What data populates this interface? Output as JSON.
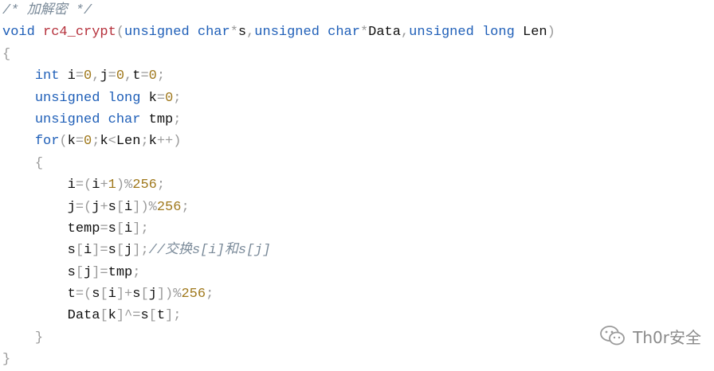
{
  "code_lines": [
    [
      {
        "t": "/* 加解密 */",
        "k": "cmt"
      }
    ],
    [
      {
        "t": "void",
        "k": "kw"
      },
      {
        "t": " ",
        "k": "var"
      },
      {
        "t": "rc4_crypt",
        "k": "fn"
      },
      {
        "t": "(",
        "k": "op"
      },
      {
        "t": "unsigned",
        "k": "kw"
      },
      {
        "t": " ",
        "k": "var"
      },
      {
        "t": "char",
        "k": "kw"
      },
      {
        "t": "*",
        "k": "op"
      },
      {
        "t": "s",
        "k": "var"
      },
      {
        "t": ",",
        "k": "op"
      },
      {
        "t": "unsigned",
        "k": "kw"
      },
      {
        "t": " ",
        "k": "var"
      },
      {
        "t": "char",
        "k": "kw"
      },
      {
        "t": "*",
        "k": "op"
      },
      {
        "t": "Data",
        "k": "var"
      },
      {
        "t": ",",
        "k": "op"
      },
      {
        "t": "unsigned",
        "k": "kw"
      },
      {
        "t": " ",
        "k": "var"
      },
      {
        "t": "long",
        "k": "kw"
      },
      {
        "t": " Len",
        "k": "var"
      },
      {
        "t": ")",
        "k": "op"
      }
    ],
    [
      {
        "t": "{",
        "k": "op"
      }
    ],
    [
      {
        "t": "    ",
        "k": "var"
      },
      {
        "t": "int",
        "k": "kw"
      },
      {
        "t": " i",
        "k": "var"
      },
      {
        "t": "=",
        "k": "op"
      },
      {
        "t": "0",
        "k": "num"
      },
      {
        "t": ",",
        "k": "op"
      },
      {
        "t": "j",
        "k": "var"
      },
      {
        "t": "=",
        "k": "op"
      },
      {
        "t": "0",
        "k": "num"
      },
      {
        "t": ",",
        "k": "op"
      },
      {
        "t": "t",
        "k": "var"
      },
      {
        "t": "=",
        "k": "op"
      },
      {
        "t": "0",
        "k": "num"
      },
      {
        "t": ";",
        "k": "op"
      }
    ],
    [
      {
        "t": "    ",
        "k": "var"
      },
      {
        "t": "unsigned",
        "k": "kw"
      },
      {
        "t": " ",
        "k": "var"
      },
      {
        "t": "long",
        "k": "kw"
      },
      {
        "t": " k",
        "k": "var"
      },
      {
        "t": "=",
        "k": "op"
      },
      {
        "t": "0",
        "k": "num"
      },
      {
        "t": ";",
        "k": "op"
      }
    ],
    [
      {
        "t": "    ",
        "k": "var"
      },
      {
        "t": "unsigned",
        "k": "kw"
      },
      {
        "t": " ",
        "k": "var"
      },
      {
        "t": "char",
        "k": "kw"
      },
      {
        "t": " tmp",
        "k": "var"
      },
      {
        "t": ";",
        "k": "op"
      }
    ],
    [
      {
        "t": "    ",
        "k": "var"
      },
      {
        "t": "for",
        "k": "kw"
      },
      {
        "t": "(",
        "k": "op"
      },
      {
        "t": "k",
        "k": "var"
      },
      {
        "t": "=",
        "k": "op"
      },
      {
        "t": "0",
        "k": "num"
      },
      {
        "t": ";",
        "k": "op"
      },
      {
        "t": "k",
        "k": "var"
      },
      {
        "t": "<",
        "k": "op"
      },
      {
        "t": "Len",
        "k": "var"
      },
      {
        "t": ";",
        "k": "op"
      },
      {
        "t": "k",
        "k": "var"
      },
      {
        "t": "++)",
        "k": "op"
      }
    ],
    [
      {
        "t": "    ",
        "k": "var"
      },
      {
        "t": "{",
        "k": "op"
      }
    ],
    [
      {
        "t": "        ",
        "k": "var"
      },
      {
        "t": "i",
        "k": "var"
      },
      {
        "t": "=(",
        "k": "op"
      },
      {
        "t": "i",
        "k": "var"
      },
      {
        "t": "+",
        "k": "op"
      },
      {
        "t": "1",
        "k": "num"
      },
      {
        "t": ")%",
        "k": "op"
      },
      {
        "t": "256",
        "k": "num"
      },
      {
        "t": ";",
        "k": "op"
      }
    ],
    [
      {
        "t": "        ",
        "k": "var"
      },
      {
        "t": "j",
        "k": "var"
      },
      {
        "t": "=(",
        "k": "op"
      },
      {
        "t": "j",
        "k": "var"
      },
      {
        "t": "+",
        "k": "op"
      },
      {
        "t": "s",
        "k": "var"
      },
      {
        "t": "[",
        "k": "op"
      },
      {
        "t": "i",
        "k": "var"
      },
      {
        "t": "])%",
        "k": "op"
      },
      {
        "t": "256",
        "k": "num"
      },
      {
        "t": ";",
        "k": "op"
      }
    ],
    [
      {
        "t": "        ",
        "k": "var"
      },
      {
        "t": "temp",
        "k": "var"
      },
      {
        "t": "=",
        "k": "op"
      },
      {
        "t": "s",
        "k": "var"
      },
      {
        "t": "[",
        "k": "op"
      },
      {
        "t": "i",
        "k": "var"
      },
      {
        "t": "];",
        "k": "op"
      }
    ],
    [
      {
        "t": "        ",
        "k": "var"
      },
      {
        "t": "s",
        "k": "var"
      },
      {
        "t": "[",
        "k": "op"
      },
      {
        "t": "i",
        "k": "var"
      },
      {
        "t": "]=",
        "k": "op"
      },
      {
        "t": "s",
        "k": "var"
      },
      {
        "t": "[",
        "k": "op"
      },
      {
        "t": "j",
        "k": "var"
      },
      {
        "t": "];",
        "k": "op"
      },
      {
        "t": "//交换s[i]和s[j]",
        "k": "cmt"
      }
    ],
    [
      {
        "t": "        ",
        "k": "var"
      },
      {
        "t": "s",
        "k": "var"
      },
      {
        "t": "[",
        "k": "op"
      },
      {
        "t": "j",
        "k": "var"
      },
      {
        "t": "]=",
        "k": "op"
      },
      {
        "t": "tmp",
        "k": "var"
      },
      {
        "t": ";",
        "k": "op"
      }
    ],
    [
      {
        "t": "        ",
        "k": "var"
      },
      {
        "t": "t",
        "k": "var"
      },
      {
        "t": "=(",
        "k": "op"
      },
      {
        "t": "s",
        "k": "var"
      },
      {
        "t": "[",
        "k": "op"
      },
      {
        "t": "i",
        "k": "var"
      },
      {
        "t": "]+",
        "k": "op"
      },
      {
        "t": "s",
        "k": "var"
      },
      {
        "t": "[",
        "k": "op"
      },
      {
        "t": "j",
        "k": "var"
      },
      {
        "t": "])%",
        "k": "op"
      },
      {
        "t": "256",
        "k": "num"
      },
      {
        "t": ";",
        "k": "op"
      }
    ],
    [
      {
        "t": "        ",
        "k": "var"
      },
      {
        "t": "Data",
        "k": "var"
      },
      {
        "t": "[",
        "k": "op"
      },
      {
        "t": "k",
        "k": "var"
      },
      {
        "t": "]^=",
        "k": "op"
      },
      {
        "t": "s",
        "k": "var"
      },
      {
        "t": "[",
        "k": "op"
      },
      {
        "t": "t",
        "k": "var"
      },
      {
        "t": "];",
        "k": "op"
      }
    ],
    [
      {
        "t": "    ",
        "k": "var"
      },
      {
        "t": "}",
        "k": "op"
      }
    ],
    [
      {
        "t": "}",
        "k": "op"
      }
    ]
  ],
  "watermark": {
    "text": "Th0r安全",
    "icon": "wechat-icon"
  },
  "colors": {
    "keyword": "#1f5fb8",
    "function": "#b5303b",
    "number": "#a0791d",
    "operator": "#9a9a9a",
    "comment": "#7a8a99"
  }
}
